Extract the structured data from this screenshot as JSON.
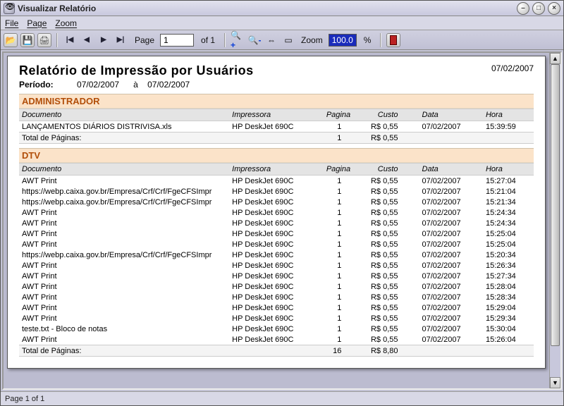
{
  "window": {
    "title": "Visualizar Relatório"
  },
  "menu": {
    "file": "File",
    "page": "Page",
    "zoom": "Zoom"
  },
  "toolbar": {
    "page_label": "Page",
    "page_value": "1",
    "of_label": "of 1",
    "zoom_label": "Zoom",
    "zoom_value": "100.0",
    "pct": "%"
  },
  "report": {
    "title": "Relatório de Impressão por Usuários",
    "date": "07/02/2007",
    "period_label": "Período:",
    "period_from": "07/02/2007",
    "period_sep": "à",
    "period_to": "07/02/2007",
    "columns": {
      "doc": "Documento",
      "imp": "Impressora",
      "pag": "Pagina",
      "cst": "Custo",
      "dat": "Data",
      "hor": "Hora"
    },
    "total_label": "Total de Páginas:",
    "sections": [
      {
        "name": "ADMINISTRADOR",
        "rows": [
          {
            "doc": "LANÇAMENTOS DIÁRIOS DISTRIVISA.xls",
            "imp": "HP DeskJet 690C",
            "pag": "1",
            "cst": "R$ 0,55",
            "dat": "07/02/2007",
            "hor": "15:39:59"
          }
        ],
        "total_pag": "1",
        "total_cst": "R$ 0,55"
      },
      {
        "name": "DTV",
        "rows": [
          {
            "doc": "AWT Print",
            "imp": "HP DeskJet 690C",
            "pag": "1",
            "cst": "R$ 0,55",
            "dat": "07/02/2007",
            "hor": "15:27:04"
          },
          {
            "doc": "https://webp.caixa.gov.br/Empresa/Crf/Crf/FgeCFSImpr",
            "imp": "HP DeskJet 690C",
            "pag": "1",
            "cst": "R$ 0,55",
            "dat": "07/02/2007",
            "hor": "15:21:04"
          },
          {
            "doc": "https://webp.caixa.gov.br/Empresa/Crf/Crf/FgeCFSImpr",
            "imp": "HP DeskJet 690C",
            "pag": "1",
            "cst": "R$ 0,55",
            "dat": "07/02/2007",
            "hor": "15:21:34"
          },
          {
            "doc": "AWT Print",
            "imp": "HP DeskJet 690C",
            "pag": "1",
            "cst": "R$ 0,55",
            "dat": "07/02/2007",
            "hor": "15:24:34"
          },
          {
            "doc": "AWT Print",
            "imp": "HP DeskJet 690C",
            "pag": "1",
            "cst": "R$ 0,55",
            "dat": "07/02/2007",
            "hor": "15:24:34"
          },
          {
            "doc": "AWT Print",
            "imp": "HP DeskJet 690C",
            "pag": "1",
            "cst": "R$ 0,55",
            "dat": "07/02/2007",
            "hor": "15:25:04"
          },
          {
            "doc": "AWT Print",
            "imp": "HP DeskJet 690C",
            "pag": "1",
            "cst": "R$ 0,55",
            "dat": "07/02/2007",
            "hor": "15:25:04"
          },
          {
            "doc": "https://webp.caixa.gov.br/Empresa/Crf/Crf/FgeCFSImpr",
            "imp": "HP DeskJet 690C",
            "pag": "1",
            "cst": "R$ 0,55",
            "dat": "07/02/2007",
            "hor": "15:20:34"
          },
          {
            "doc": "AWT Print",
            "imp": "HP DeskJet 690C",
            "pag": "1",
            "cst": "R$ 0,55",
            "dat": "07/02/2007",
            "hor": "15:26:34"
          },
          {
            "doc": "AWT Print",
            "imp": "HP DeskJet 690C",
            "pag": "1",
            "cst": "R$ 0,55",
            "dat": "07/02/2007",
            "hor": "15:27:34"
          },
          {
            "doc": "AWT Print",
            "imp": "HP DeskJet 690C",
            "pag": "1",
            "cst": "R$ 0,55",
            "dat": "07/02/2007",
            "hor": "15:28:04"
          },
          {
            "doc": "AWT Print",
            "imp": "HP DeskJet 690C",
            "pag": "1",
            "cst": "R$ 0,55",
            "dat": "07/02/2007",
            "hor": "15:28:34"
          },
          {
            "doc": "AWT Print",
            "imp": "HP DeskJet 690C",
            "pag": "1",
            "cst": "R$ 0,55",
            "dat": "07/02/2007",
            "hor": "15:29:04"
          },
          {
            "doc": "AWT Print",
            "imp": "HP DeskJet 690C",
            "pag": "1",
            "cst": "R$ 0,55",
            "dat": "07/02/2007",
            "hor": "15:29:34"
          },
          {
            "doc": "teste.txt - Bloco de notas",
            "imp": "HP DeskJet 690C",
            "pag": "1",
            "cst": "R$ 0,55",
            "dat": "07/02/2007",
            "hor": "15:30:04"
          },
          {
            "doc": "AWT Print",
            "imp": "HP DeskJet 690C",
            "pag": "1",
            "cst": "R$ 0,55",
            "dat": "07/02/2007",
            "hor": "15:26:04"
          }
        ],
        "total_pag": "16",
        "total_cst": "R$ 8,80"
      }
    ]
  },
  "status": {
    "text": "Page 1 of 1"
  }
}
